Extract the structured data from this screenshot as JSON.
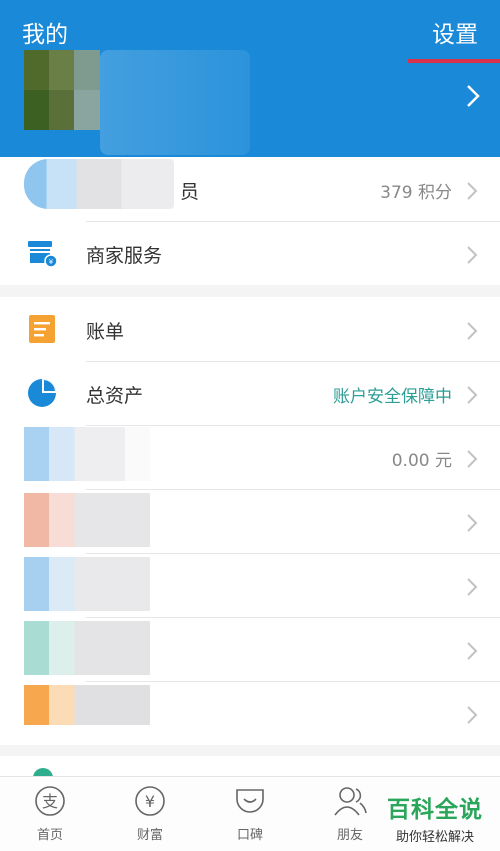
{
  "header": {
    "title": "我的",
    "settings": "设置",
    "accent": "#1a8ad8"
  },
  "group1": {
    "member_label": "员",
    "member_points": "379 积分",
    "merchant_label": "商家服务"
  },
  "group2": {
    "bill_label": "账单",
    "assets_label": "总资产",
    "assets_status": "账户安全保障中",
    "balance_value": "0.00 元"
  },
  "tabbar": {
    "home": "首页",
    "wealth": "财富",
    "koubei": "口碑",
    "friends": "朋友"
  },
  "watermark": {
    "title": "百科全说",
    "subtitle": "助你轻松解决"
  },
  "icons": {
    "merchant": "store-icon",
    "bill": "bill-icon",
    "assets": "pie-chart-icon",
    "chevron": "chevron-right-icon"
  }
}
